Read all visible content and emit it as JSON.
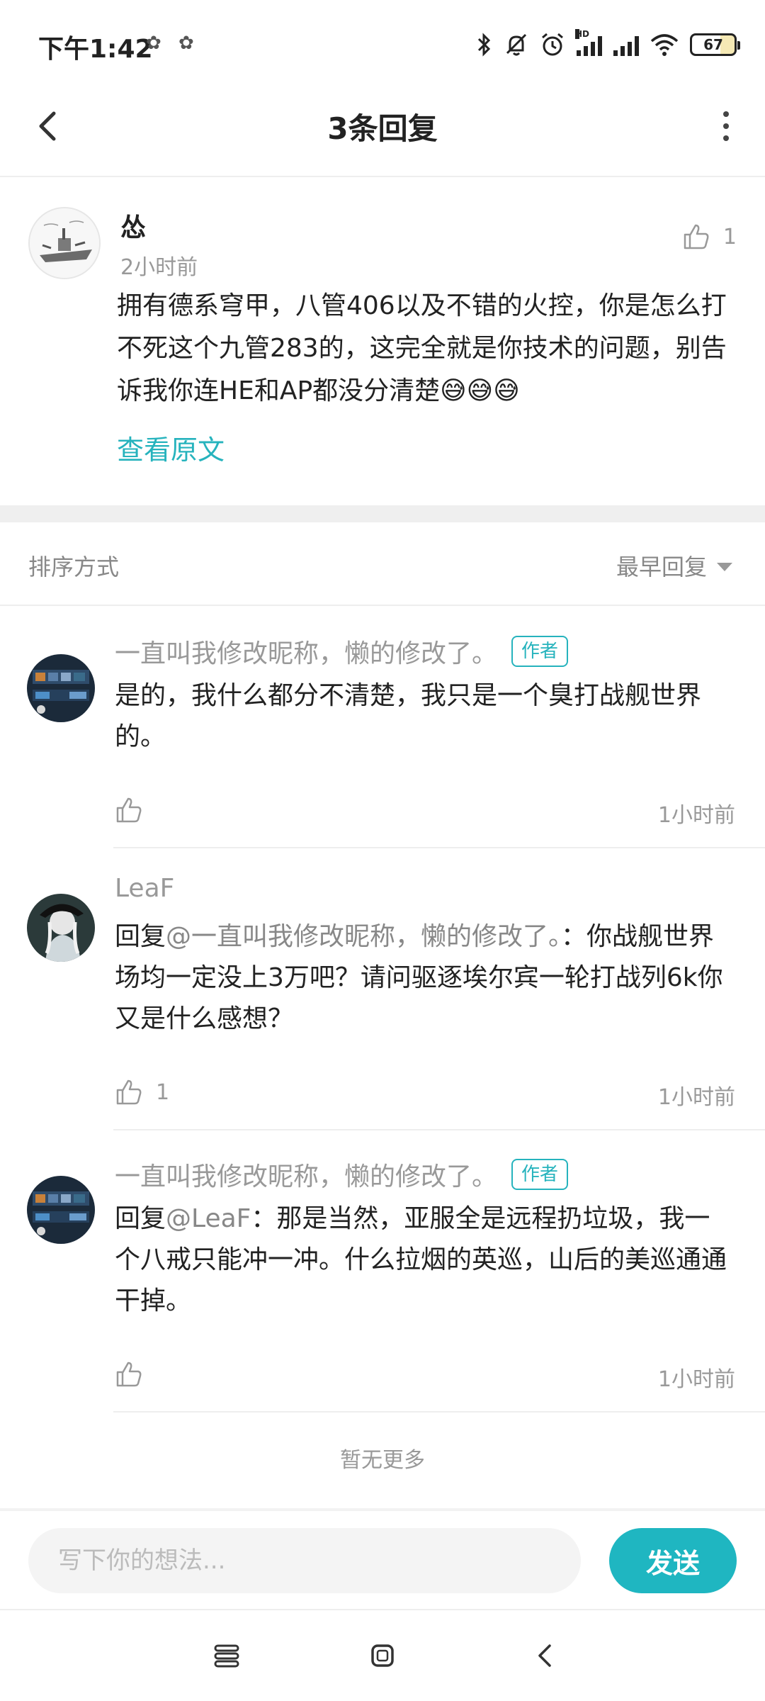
{
  "status_bar": {
    "time": "下午1:42",
    "battery": "67"
  },
  "header": {
    "title": "3条回复"
  },
  "original_comment": {
    "author": "怂",
    "time": "2小时前",
    "like_count": "1",
    "content": "拥有德系穹甲，八管406以及不错的火控，你是怎么打不死这个九管283的，这完全就是你技术的问题，别告诉我你连HE和AP都没分清楚😅😅😅",
    "view_original": "查看原文"
  },
  "sort": {
    "label": "排序方式",
    "selected": "最早回复"
  },
  "replies": [
    {
      "author": "一直叫我修改昵称，懒的修改了。",
      "badge": "作者",
      "prefix": "",
      "mention": "",
      "text": "是的，我什么都分不清楚，我只是一个臭打战舰世界的。",
      "likes": "",
      "time": "1小时前"
    },
    {
      "author": "LeaF",
      "badge": "",
      "prefix": "回复",
      "mention": "@一直叫我修改昵称，懒的修改了。",
      "text": "：你战舰世界场均一定没上3万吧？请问驱逐埃尔宾一轮打战列6k你又是什么感想？",
      "likes": "1",
      "time": "1小时前"
    },
    {
      "author": "一直叫我修改昵称，懒的修改了。",
      "badge": "作者",
      "prefix": "回复",
      "mention": "@LeaF",
      "text": "：那是当然，亚服全是远程扔垃圾，我一个八戒只能冲一冲。什么拉烟的英巡，山后的美巡通通干掉。",
      "likes": "",
      "time": "1小时前"
    }
  ],
  "no_more": "暂无更多",
  "input": {
    "placeholder": "写下你的想法...",
    "send_label": "发送"
  },
  "colors": {
    "accent": "#1fb6c1",
    "muted_text": "#999999"
  },
  "icons": {
    "back": "back-arrow-icon",
    "more": "more-vertical-icon",
    "like": "thumbs-up-icon",
    "dropdown": "triangle-down-icon"
  }
}
